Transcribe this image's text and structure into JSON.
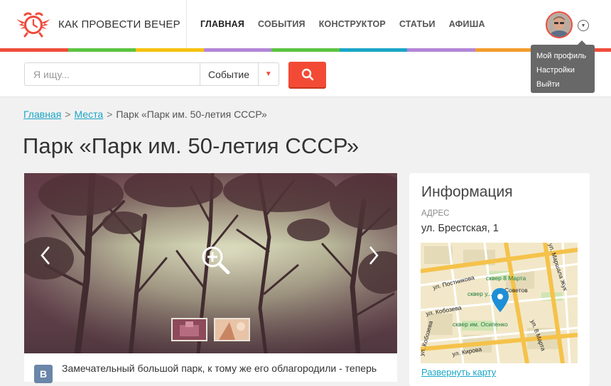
{
  "header": {
    "logo_text": "КАК ПРОВЕСТИ ВЕЧЕР",
    "nav": [
      {
        "label": "ГЛАВНАЯ",
        "active": true
      },
      {
        "label": "СОБЫТИЯ",
        "active": false
      },
      {
        "label": "КОНСТРУКТОР",
        "active": false
      },
      {
        "label": "СТАТЬИ",
        "active": false
      },
      {
        "label": "АФИША",
        "active": false
      }
    ],
    "stripe_colors": [
      "#ef4d3c",
      "#5cc443",
      "#f5c10f",
      "#b386d8",
      "#5cc443",
      "#1aa6c7",
      "#b386d8",
      "#f39c2d",
      "#ef4d3c"
    ]
  },
  "user_menu": {
    "items": [
      "Мой профиль",
      "Настройки",
      "Выйти"
    ]
  },
  "search": {
    "placeholder": "Я ищу...",
    "category": "Событие"
  },
  "breadcrumb": {
    "home": "Главная",
    "places": "Места",
    "separator": ">",
    "current": "Парк «Парк им. 50-летия СССР»"
  },
  "page": {
    "title": "Парк «Парк им. 50-летия СССР»"
  },
  "gallery": {
    "social_text": "Замечательный большой парк, к тому же его облагородили - теперь"
  },
  "info": {
    "title": "Информация",
    "address_label": "АДРЕС",
    "address": "ул. Брестская, 1",
    "map_link": "Развернуть карту",
    "map_labels": [
      "ул. Постникова",
      "сквер 8 Марта",
      "ул. Кобозева",
      "сквер у...",
      "Советов",
      "сквер им. Осипенко",
      "ул. Кирова",
      "ул. 8 Марта",
      "ул. Маршала Жук",
      "ул. Кобозева"
    ]
  },
  "colors": {
    "accent": "#f24a35",
    "link": "#1aa6c7"
  }
}
